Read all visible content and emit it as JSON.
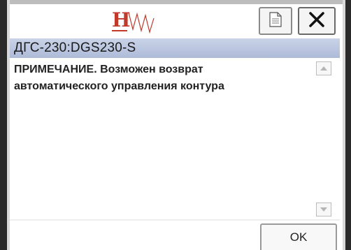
{
  "header": {
    "logo_letter": "H",
    "logo_name": "hw-logo",
    "doc_icon": "document-icon",
    "close_icon": "close-icon"
  },
  "title_bar": {
    "title": "ДГС-230:DGS230-S"
  },
  "message": {
    "lines": [
      "ПРИМЕЧАНИЕ. Возможен возврат",
      "автоматического управления контура"
    ]
  },
  "scrollbar": {
    "up_icon": "scroll-up-arrow-icon",
    "down_icon": "scroll-down-arrow-icon"
  },
  "footer": {
    "ok_label": "OK"
  },
  "colors": {
    "title_bar_bg": "#b8c4de",
    "logo_red": "#c0392b",
    "border_dark": "#2a2a2a"
  }
}
